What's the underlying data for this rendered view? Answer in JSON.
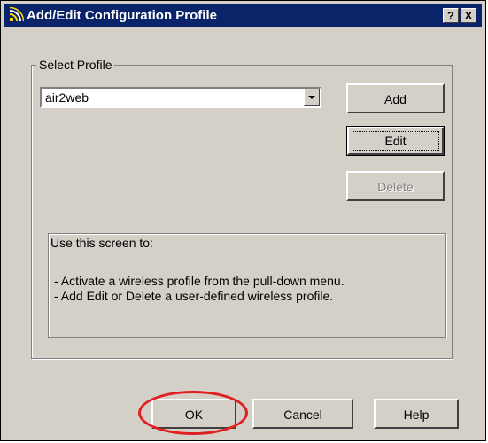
{
  "window": {
    "title": "Add/Edit Configuration Profile",
    "help_button": "?",
    "close_button": "X"
  },
  "profile_group": {
    "legend": "Select Profile",
    "selected_profile": "air2web"
  },
  "buttons": {
    "add": "Add",
    "edit": "Edit",
    "delete": "Delete",
    "ok": "OK",
    "cancel": "Cancel",
    "help": "Help"
  },
  "info": {
    "heading": "Use this screen to:",
    "lines": [
      "- Activate a wireless profile from the pull-down menu.",
      "- Add Edit or Delete a user-defined wireless profile."
    ]
  },
  "colors": {
    "titlebar": "#0a246a",
    "dialog_face": "#d4d0c8",
    "highlight_circle": "#e02020"
  }
}
